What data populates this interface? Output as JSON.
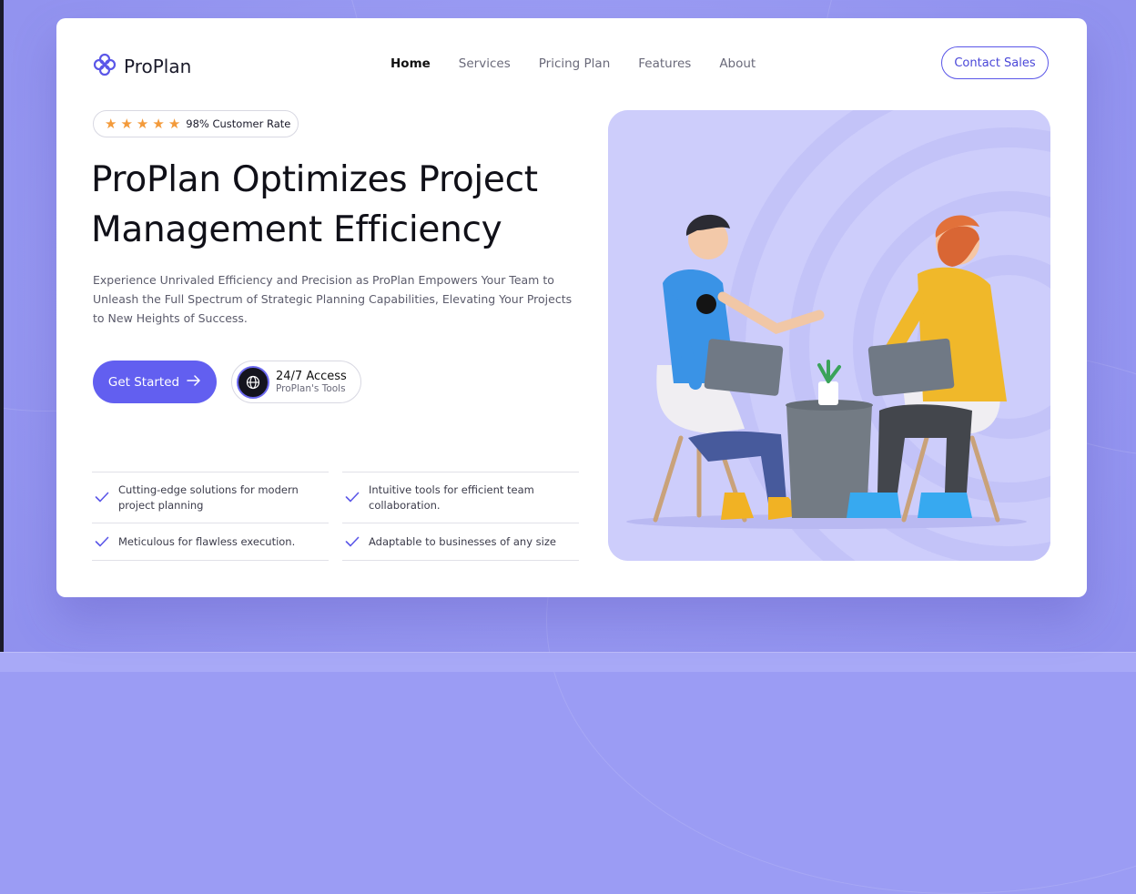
{
  "brand": {
    "name": "ProPlan",
    "accent": "#625ff0",
    "background": "#9b9cf4"
  },
  "nav": {
    "items": [
      {
        "label": "Home",
        "active": true
      },
      {
        "label": "Services"
      },
      {
        "label": "Pricing Plan"
      },
      {
        "label": "Features"
      },
      {
        "label": "About"
      }
    ],
    "contact_label": "Contact Sales"
  },
  "hero": {
    "rating": {
      "stars": 5,
      "text": "98% Customer Rate"
    },
    "headline_line1": "ProPlan Optimizes Project",
    "headline_line2": "Management Efficiency",
    "description": "Experience Unrivaled Efficiency and Precision as ProPlan Empowers Your Team to Unleash the Full Spectrum of Strategic Planning Capabilities, Elevating Your Projects to New Heights of Success.",
    "cta_label": "Get Started",
    "access_title": "24/7 Access",
    "access_subtitle": "ProPlan's Tools"
  },
  "features": [
    "Cutting-edge solutions for modern project planning",
    "Intuitive tools for efficient team collaboration.",
    "Meticulous for flawless execution.",
    "Adaptable to businesses of any size"
  ],
  "icons": {
    "logo": "logo-flower-icon",
    "star": "star-icon",
    "arrow": "arrow-right-icon",
    "globe": "globe-icon",
    "check": "check-icon"
  }
}
